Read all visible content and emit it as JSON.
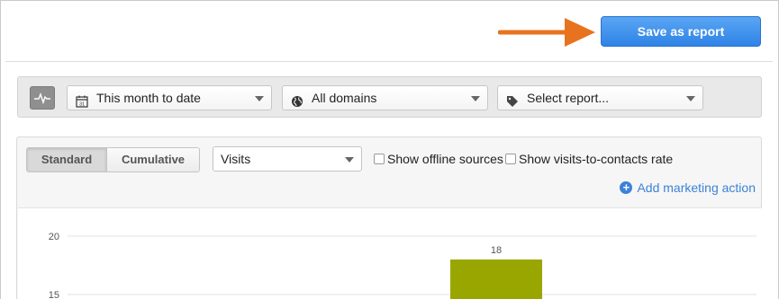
{
  "header": {
    "save_label": "Save as report"
  },
  "filters": {
    "date_range": "This month to date",
    "domain": "All domains",
    "report": "Select report..."
  },
  "controls": {
    "view_modes": [
      "Standard",
      "Cumulative"
    ],
    "active_view": "Standard",
    "metric": "Visits",
    "show_offline_label": "Show offline sources",
    "show_rate_label": "Show visits-to-contacts rate",
    "add_action_label": "Add marketing action"
  },
  "icons": {
    "pulse": "activity-chart-icon",
    "calendar": "calendar-icon",
    "globe": "globe-icon",
    "tag": "tag-icon",
    "add": "plus-circle-icon",
    "arrow": "orange-arrow-pointer"
  },
  "colors": {
    "accent": "#3d82d8",
    "bar": "#9aa600",
    "arrow": "#e8731e"
  },
  "chart_data": {
    "type": "bar",
    "y_ticks": [
      20,
      15
    ],
    "bars": [
      {
        "value": 18,
        "label": "18"
      }
    ],
    "grid": true
  }
}
